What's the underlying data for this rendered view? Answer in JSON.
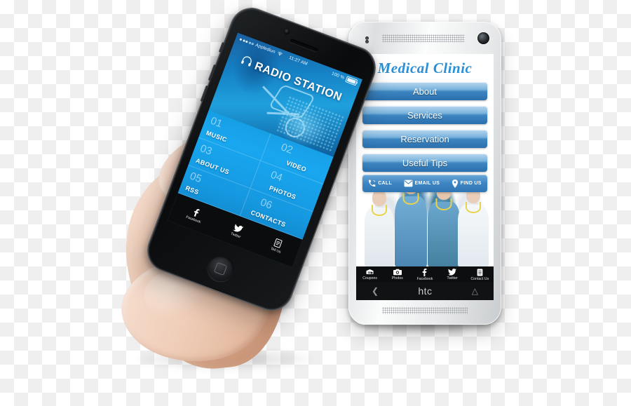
{
  "scene": {
    "description": "Hand holding a black iPhone with a Radio Station app in front of a white HTC phone showing a Medical Clinic app",
    "background": "transparent-checkerboard"
  },
  "iphone": {
    "device_name": "iPhone",
    "status_bar": {
      "carrier": "Applediun",
      "signal_dots": 5,
      "signal_filled": 3,
      "wifi_icon": "wifi-icon",
      "time": "11:27 AM",
      "battery_percent": "100 %"
    },
    "app": {
      "title": "RADIO STATION",
      "title_icon": "headphones-icon",
      "menu": [
        {
          "num": "01",
          "label": "MUSIC"
        },
        {
          "num": "02",
          "label": "VIDEO"
        },
        {
          "num": "03",
          "label": "ABOUT US"
        },
        {
          "num": "04",
          "label": "PHOTOS"
        },
        {
          "num": "05",
          "label": "RSS"
        },
        {
          "num": "06",
          "label": "CONTACTS"
        }
      ],
      "tabs": [
        {
          "label": "Facebook",
          "icon": "facebook-icon"
        },
        {
          "label": "Twitter",
          "icon": "twitter-icon"
        },
        {
          "label": "Tell Us",
          "icon": "form-icon"
        }
      ],
      "colors": {
        "accent": "#18a7ef",
        "deep": "#0f6fae"
      }
    },
    "home_button": "home-button"
  },
  "htc": {
    "device_name": "HTC",
    "brand_label": "htc",
    "nav": {
      "back_icon": "back-chevron-icon",
      "home_icon": "home-icon"
    },
    "app": {
      "title": "Medical Clinic",
      "buttons": [
        "About",
        "Services",
        "Reservation",
        "Useful Tips"
      ],
      "actions": [
        {
          "label": "CALL",
          "icon": "phone-icon"
        },
        {
          "label": "EMAIL US",
          "icon": "envelope-icon"
        },
        {
          "label": "FIND US",
          "icon": "map-pin-icon"
        }
      ],
      "tabs": [
        {
          "label": "Coupons",
          "icon": "coupon-icon"
        },
        {
          "label": "Photos",
          "icon": "camera-icon"
        },
        {
          "label": "Facebook",
          "icon": "facebook-icon"
        },
        {
          "label": "Twitter",
          "icon": "twitter-icon"
        },
        {
          "label": "Contact Us",
          "icon": "contact-list-icon"
        }
      ],
      "colors": {
        "title": "#2a8fd4",
        "button_top": "#b9d7ee",
        "button_bottom": "#2a6fae"
      }
    }
  }
}
